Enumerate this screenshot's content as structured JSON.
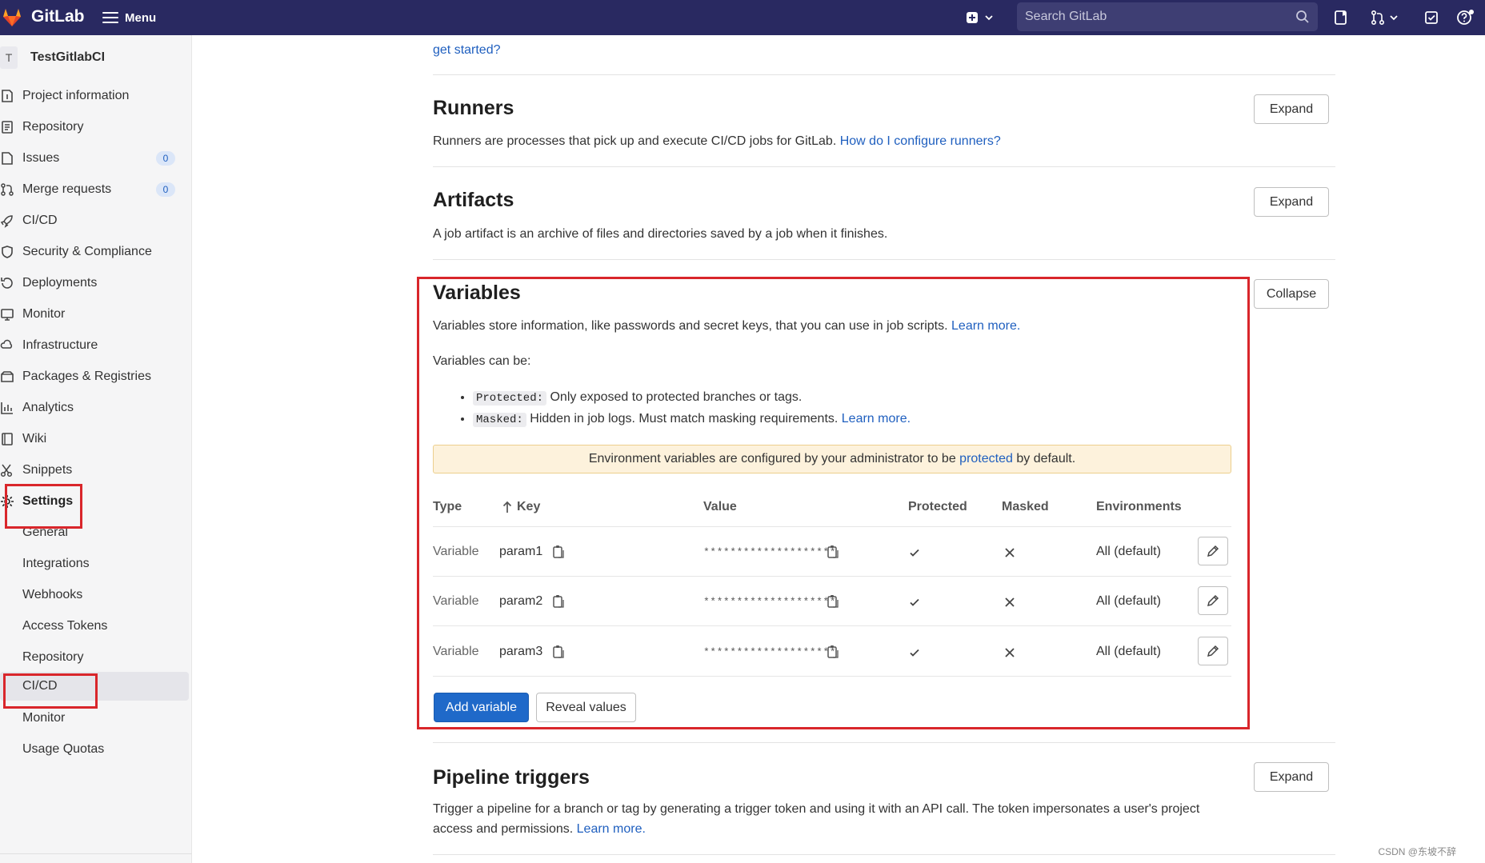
{
  "topbar": {
    "brand": "GitLab",
    "menu_label": "Menu",
    "search_placeholder": "Search GitLab"
  },
  "sidebar": {
    "project_avatar_letter": "T",
    "project_name": "TestGitlabCI",
    "items": [
      {
        "label": "Project information",
        "icon": "info-doc-icon"
      },
      {
        "label": "Repository",
        "icon": "repository-icon"
      },
      {
        "label": "Issues",
        "icon": "issues-icon",
        "count": "0"
      },
      {
        "label": "Merge requests",
        "icon": "merge-request-icon",
        "count": "0"
      },
      {
        "label": "CI/CD",
        "icon": "rocket-icon"
      },
      {
        "label": "Security & Compliance",
        "icon": "shield-icon"
      },
      {
        "label": "Deployments",
        "icon": "deployments-icon"
      },
      {
        "label": "Monitor",
        "icon": "monitor-icon"
      },
      {
        "label": "Infrastructure",
        "icon": "cloud-gear-icon"
      },
      {
        "label": "Packages & Registries",
        "icon": "package-icon"
      },
      {
        "label": "Analytics",
        "icon": "chart-icon"
      },
      {
        "label": "Wiki",
        "icon": "book-icon"
      },
      {
        "label": "Snippets",
        "icon": "scissors-icon"
      },
      {
        "label": "Settings",
        "icon": "gear-icon"
      }
    ],
    "settings_sub": [
      "General",
      "Integrations",
      "Webhooks",
      "Access Tokens",
      "Repository",
      "CI/CD",
      "Monitor",
      "Usage Quotas"
    ]
  },
  "top_partial": {
    "link": "get started?"
  },
  "runners": {
    "title": "Runners",
    "desc": "Runners are processes that pick up and execute CI/CD jobs for GitLab.",
    "link": "How do I configure runners?",
    "button": "Expand"
  },
  "artifacts": {
    "title": "Artifacts",
    "desc": "A job artifact is an archive of files and directories saved by a job when it finishes.",
    "button": "Expand"
  },
  "variables": {
    "title": "Variables",
    "desc": "Variables store information, like passwords and secret keys, that you can use in job scripts.",
    "desc_link": "Learn more.",
    "can_be": "Variables can be:",
    "protected_kw": "Protected:",
    "protected_text": "Only exposed to protected branches or tags.",
    "masked_kw": "Masked:",
    "masked_text": "Hidden in job logs. Must match masking requirements.",
    "masked_link": "Learn more.",
    "notice_before": "Environment variables are configured by your administrator to be",
    "notice_link": "protected",
    "notice_after": "by default.",
    "button": "Collapse",
    "columns": {
      "type": "Type",
      "key": "Key",
      "value": "Value",
      "protected": "Protected",
      "masked": "Masked",
      "environments": "Environments"
    },
    "rows": [
      {
        "type": "Variable",
        "key": "param1",
        "value": "********************",
        "environment": "All (default)"
      },
      {
        "type": "Variable",
        "key": "param2",
        "value": "********************",
        "environment": "All (default)"
      },
      {
        "type": "Variable",
        "key": "param3",
        "value": "********************",
        "environment": "All (default)"
      }
    ],
    "add_button": "Add variable",
    "reveal_button": "Reveal values"
  },
  "pipeline_triggers": {
    "title": "Pipeline triggers",
    "desc": "Trigger a pipeline for a branch or tag by generating a trigger token and using it with an API call. The token impersonates a user's project access and permissions.",
    "link": "Learn more.",
    "button": "Expand"
  },
  "watermark": "CSDN @东坡不辞",
  "colors": {
    "topbar": "#292961",
    "primary": "#1f69c9",
    "highlight": "#d9262b",
    "link": "#1f5fbf"
  }
}
